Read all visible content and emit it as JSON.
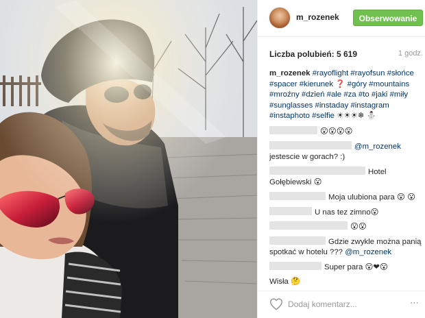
{
  "header": {
    "username": "m_rozenek",
    "follow_label": "Obserwowanie"
  },
  "meta": {
    "likes": "Liczba polubień: 5 619",
    "time": "1 godz."
  },
  "caption": {
    "user": "m_rozenek",
    "segments": [
      {
        "t": "#rayoflight",
        "tag": true
      },
      {
        "t": " "
      },
      {
        "t": "#rayofsun",
        "tag": true
      },
      {
        "t": " "
      },
      {
        "t": "#słońce",
        "tag": true
      },
      {
        "t": " "
      },
      {
        "t": "#spacer",
        "tag": true
      },
      {
        "t": " "
      },
      {
        "t": "#kierunek",
        "tag": true
      },
      {
        "t": " ❓ "
      },
      {
        "t": "#góry",
        "tag": true
      },
      {
        "t": " "
      },
      {
        "t": "#mountains",
        "tag": true
      },
      {
        "t": " "
      },
      {
        "t": "#mroźny",
        "tag": true
      },
      {
        "t": " "
      },
      {
        "t": "#dzień",
        "tag": true
      },
      {
        "t": " "
      },
      {
        "t": "#ale",
        "tag": true
      },
      {
        "t": " "
      },
      {
        "t": "#za",
        "tag": true
      },
      {
        "t": " "
      },
      {
        "t": "#to",
        "tag": true
      },
      {
        "t": " "
      },
      {
        "t": "#jaki",
        "tag": true
      },
      {
        "t": " "
      },
      {
        "t": "#miły",
        "tag": true
      },
      {
        "t": " "
      },
      {
        "t": "#sunglasses",
        "tag": true
      },
      {
        "t": " "
      },
      {
        "t": "#instaday",
        "tag": true
      },
      {
        "t": " "
      },
      {
        "t": "#instagram",
        "tag": true
      },
      {
        "t": " "
      },
      {
        "t": "#instaphoto",
        "tag": true
      },
      {
        "t": " "
      },
      {
        "t": "#selfie",
        "tag": true
      },
      {
        "t": " ☀☀☀❄ ⛄"
      }
    ]
  },
  "comments": [
    {
      "blur": 70,
      "text": "😮😮😮😮"
    },
    {
      "blur": 120,
      "mention": "@m_rozenek",
      "text": " jestescie w gorach? :)"
    },
    {
      "blur": 140,
      "text": "Hotel Gołębiewski 😮"
    },
    {
      "blur": 82,
      "text": "Moja ulubiona para 😮 😮"
    },
    {
      "blur": 62,
      "text": "U nas tez zimno😮"
    },
    {
      "blur": 114,
      "text": "😮😮"
    },
    {
      "blur": 82,
      "text": "Gdzie zwykle można panią spotkać w hotelu ??? ",
      "mention_after": "@m_rozenek"
    },
    {
      "blur": 76,
      "text": "Super para 😮❤😮"
    },
    {
      "blur": 0,
      "text": "Wisła 🤔"
    }
  ],
  "footer": {
    "placeholder": "Dodaj komentarz...",
    "more_label": "⋯"
  },
  "colors": {
    "follow_green": "#70c050",
    "hashtag_blue": "#003569",
    "muted_gray": "#999999"
  },
  "icons": {
    "like": "heart-icon",
    "options": "more-icon"
  }
}
